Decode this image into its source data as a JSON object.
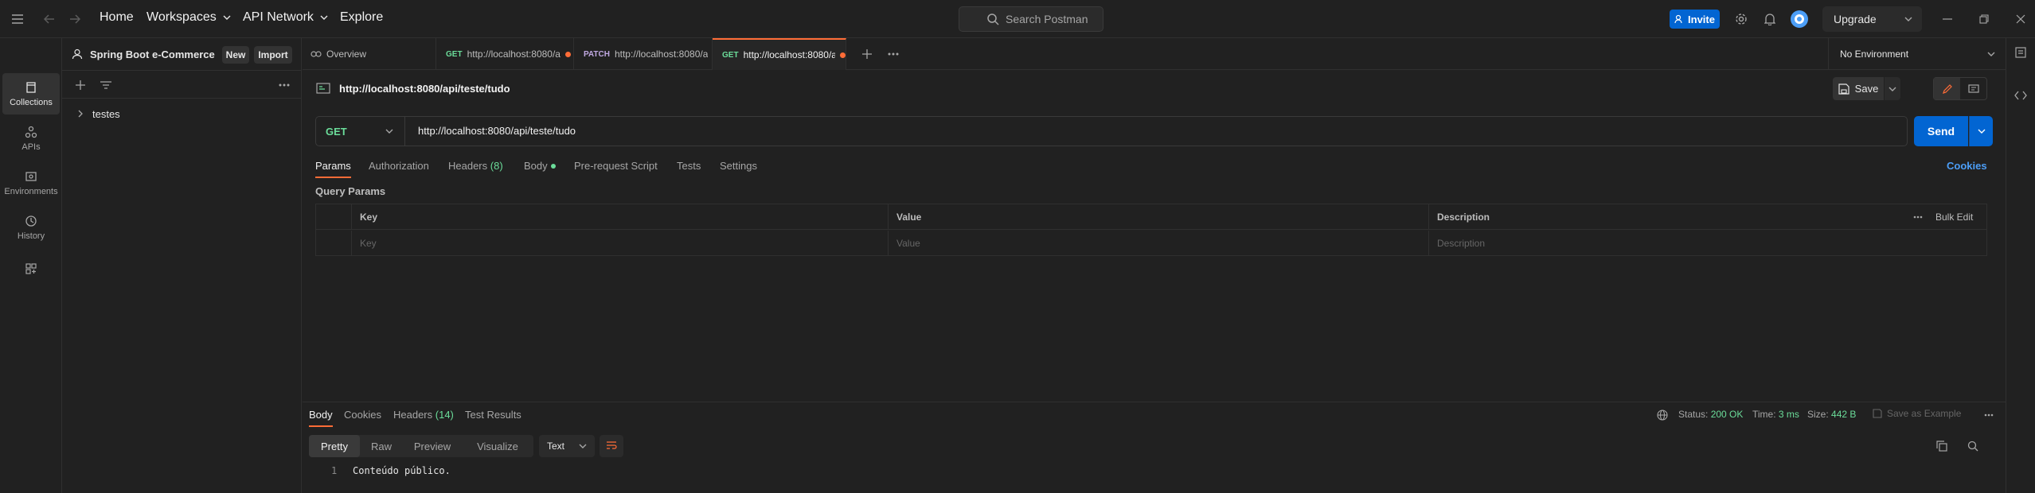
{
  "topbar": {
    "home": "Home",
    "workspaces": "Workspaces",
    "api_network": "API Network",
    "explore": "Explore",
    "search_placeholder": "Search Postman",
    "invite": "Invite",
    "upgrade": "Upgrade"
  },
  "rail": {
    "collections": "Collections",
    "apis": "APIs",
    "environments": "Environments",
    "history": "History"
  },
  "sidebar": {
    "workspace_name": "Spring Boot e-Commerce",
    "new_button": "New",
    "import_button": "Import",
    "items": [
      {
        "label": "testes"
      }
    ]
  },
  "tabs": [
    {
      "method": "",
      "label": "Overview"
    },
    {
      "method": "GET",
      "label": "http://localhost:8080/a"
    },
    {
      "method": "PATCH",
      "label": "http://localhost:8080/a"
    },
    {
      "method": "GET",
      "label": "http://localhost:8080/a"
    }
  ],
  "environment": "No Environment",
  "request": {
    "title": "http://localhost:8080/api/teste/tudo",
    "save": "Save",
    "method": "GET",
    "url": "http://localhost:8080/api/teste/tudo",
    "send": "Send",
    "subtabs": {
      "params": "Params",
      "authorization": "Authorization",
      "headers": "Headers",
      "headers_count": "(8)",
      "body": "Body",
      "prerequest": "Pre-request Script",
      "tests": "Tests",
      "settings": "Settings"
    },
    "cookies": "Cookies",
    "query_params_label": "Query Params",
    "table": {
      "col_key": "Key",
      "col_value": "Value",
      "col_description": "Description",
      "bulk_edit": "Bulk Edit",
      "ph_key": "Key",
      "ph_value": "Value",
      "ph_description": "Description"
    }
  },
  "response": {
    "tabs": {
      "body": "Body",
      "cookies": "Cookies",
      "headers": "Headers",
      "headers_count": "(14)",
      "test_results": "Test Results"
    },
    "status_label": "Status:",
    "status_value": "200 OK",
    "time_label": "Time:",
    "time_value": "3 ms",
    "size_label": "Size:",
    "size_value": "442 B",
    "save_as_example": "Save as Example",
    "views": {
      "pretty": "Pretty",
      "raw": "Raw",
      "preview": "Preview",
      "visualize": "Visualize"
    },
    "format": "Text",
    "line_number": "1",
    "body_text": "Conteúdo público."
  },
  "colors": {
    "accent_orange": "#ff6c37",
    "primary_blue": "#0265d2",
    "get_green": "#6bdd9a",
    "patch_purple": "#c0a8e1"
  }
}
